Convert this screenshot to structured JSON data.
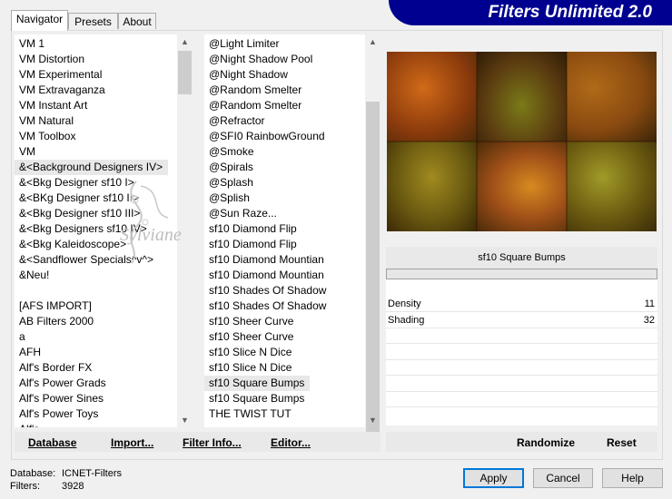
{
  "tabs": [
    "Navigator",
    "Presets",
    "About"
  ],
  "active_tab": "Navigator",
  "banner_title": "Filters Unlimited 2.0",
  "categories": [
    "VM 1",
    "VM Distortion",
    "VM Experimental",
    "VM Extravaganza",
    "VM Instant Art",
    "VM Natural",
    "VM Toolbox",
    "VM",
    "&<Background Designers IV>",
    "&<Bkg Designer sf10 I>",
    "&<BKg Designer sf10 II>",
    "&<Bkg Designer sf10 III>",
    "&<Bkg Designers sf10 IV>",
    "&<Bkg Kaleidoscope>",
    "&<Sandflower Specials^v^>",
    "&Neu!",
    "",
    "[AFS IMPORT]",
    "AB Filters 2000",
    "a",
    "AFH",
    "Alf's Border FX",
    "Alf's Power Grads",
    "Alf's Power Sines",
    "Alf's Power Toys",
    "Alf's..."
  ],
  "selected_category": "&<Background Designers IV>",
  "filters": [
    "@Light Limiter",
    "@Night Shadow Pool",
    "@Night Shadow",
    "@Random Smelter",
    "@Random Smelter",
    "@Refractor",
    "@SFI0 RainbowGround",
    "@Smoke",
    "@Spirals",
    "@Splash",
    "@Splish",
    "@Sun Raze...",
    "sf10 Diamond Flip",
    "sf10 Diamond Flip",
    "sf10 Diamond Mountian",
    "sf10 Diamond Mountian",
    "sf10 Shades Of Shadow",
    "sf10 Shades Of Shadow",
    "sf10 Sheer Curve",
    "sf10 Sheer Curve",
    "sf10 Slice N Dice",
    "sf10 Slice N Dice",
    "sf10 Square Bumps",
    "sf10 Square Bumps",
    "THE TWIST TUT"
  ],
  "selected_filter": "sf10 Square Bumps",
  "watermark": "Sylviane",
  "filter_name": "sf10 Square Bumps",
  "params": [
    {
      "name": "Density",
      "value": "11"
    },
    {
      "name": "Shading",
      "value": "32"
    }
  ],
  "buttons": {
    "database": "Database",
    "import": "Import...",
    "filter_info": "Filter Info...",
    "editor": "Editor...",
    "randomize": "Randomize",
    "reset": "Reset",
    "apply": "Apply",
    "cancel": "Cancel",
    "help": "Help"
  },
  "footer": {
    "database_label": "Database:",
    "database_value": "ICNET-Filters",
    "filters_label": "Filters:",
    "filters_value": "3928"
  },
  "icons": {
    "scroll_up": "up-arrow-icon",
    "scroll_down": "down-arrow-icon"
  }
}
